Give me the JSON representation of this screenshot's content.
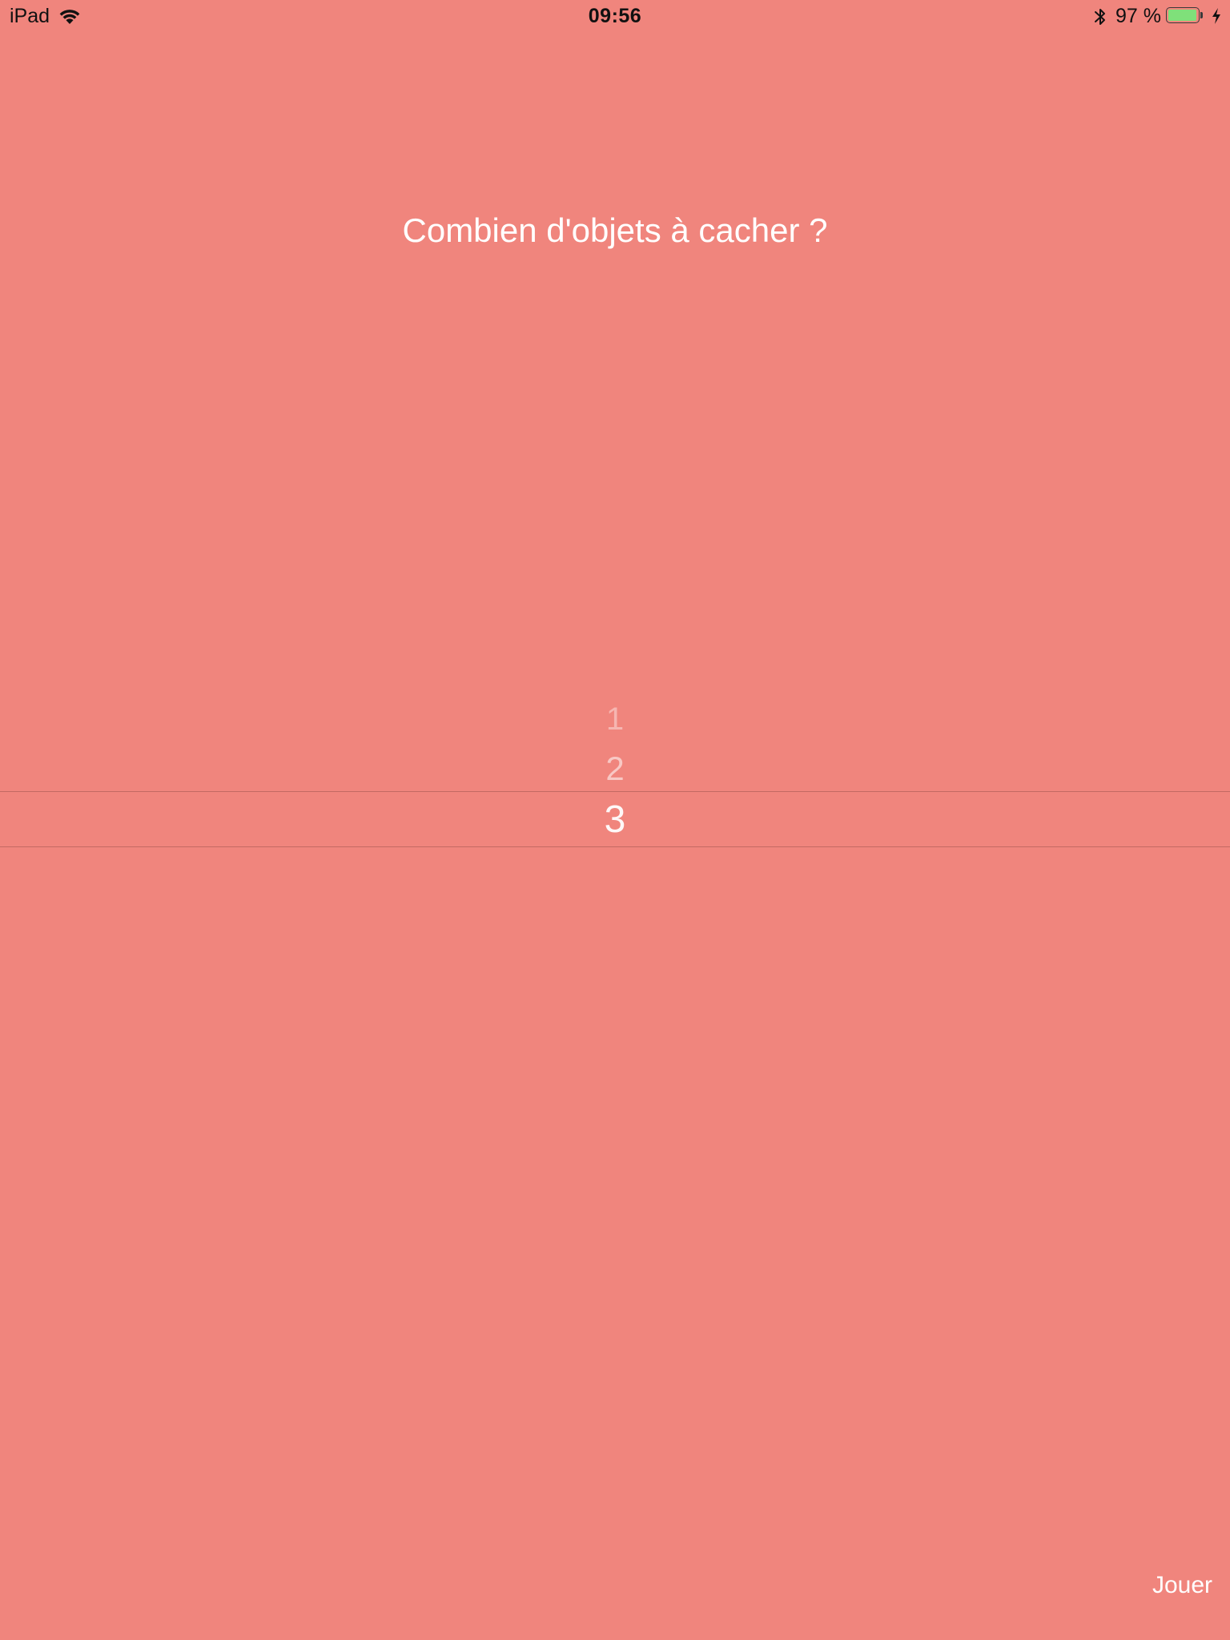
{
  "status_bar": {
    "device": "iPad",
    "time": "09:56",
    "battery_percent": "97 %",
    "battery_level": 0.97,
    "battery_color": "#7FE07A",
    "icons": [
      "wifi-icon",
      "bluetooth-icon",
      "battery-icon",
      "charging-icon"
    ]
  },
  "main": {
    "title": "Combien d'objets à cacher ?",
    "background_color": "#F0857D",
    "picker": {
      "options": [
        "1",
        "2",
        "3"
      ],
      "selected": "3"
    },
    "play_label": "Jouer"
  }
}
